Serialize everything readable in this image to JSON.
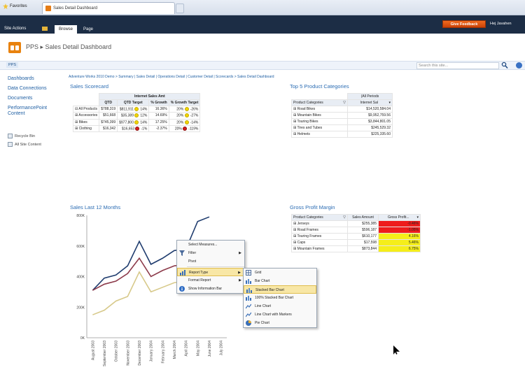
{
  "browser": {
    "favorites_label": "Favorites",
    "tab_title": "Sales Detail Dashboard"
  },
  "ribbon": {
    "site_actions": "Site Actions",
    "tab_browse": "Browse",
    "tab_page": "Page",
    "give_feedback": "Give Feedback",
    "user": "Hej Javahen"
  },
  "header": {
    "title": "PPS ▸ Sales Detail Dashboard",
    "topnav_item": "PPS",
    "search_placeholder": "Search this site..."
  },
  "sidebar": {
    "items": [
      {
        "label": "Dashboards"
      },
      {
        "label": "Data Connections"
      },
      {
        "label": "Documents"
      },
      {
        "label": "PerformancePoint Content"
      }
    ],
    "recycle_bin": "Recycle Bin",
    "all_site_content": "All Site Content"
  },
  "breadcrumb": "Adventure Works 2010 Demo > Summary | Sales Detail | Operations Detail | Customer Detail | Scorecards > Sales Detail Dashboard",
  "scorecard": {
    "title": "Sales Scorecard",
    "group_header": "Internet Sales Amt",
    "columns": [
      "QTD",
      "QTD Target",
      "% Growth",
      "% Growth Target"
    ],
    "rows": [
      {
        "name": "⊟ All Products",
        "qtd": "$788,319",
        "target": "$811,911",
        "target_pct": "14%",
        "growth": "16.36%",
        "growth_target": "20%",
        "growth_pct": "-26%",
        "ind1": "yellow",
        "ind2": "yellow"
      },
      {
        "name": "⊞ Accessories",
        "qtd": "$51,668",
        "target": "$35,389",
        "target_pct": "12%",
        "growth": "14.69%",
        "growth_target": "20%",
        "growth_pct": "-27%",
        "ind1": "yellow",
        "ind2": "yellow"
      },
      {
        "name": "⊞ Bikes",
        "qtd": "$745,399",
        "target": "$977,800",
        "target_pct": "14%",
        "growth": "17.25%",
        "growth_target": "20%",
        "growth_pct": "-14%",
        "ind1": "yellow",
        "ind2": "yellow"
      },
      {
        "name": "⊞ Clothing",
        "qtd": "$16,342",
        "target": "$16,653",
        "target_pct": "-1%",
        "growth": "-2.37%",
        "growth_target": "20%",
        "growth_pct": "-119%",
        "ind1": "red",
        "ind2": "red"
      }
    ]
  },
  "top5": {
    "title": "Top 5 Product Categories",
    "period_header": "(All Periods",
    "col_category": "Product Categories",
    "col_value": "Internet Sal",
    "rows": [
      {
        "name": "⊞ Road Bikes",
        "value": "$14,520,584.04"
      },
      {
        "name": "⊞ Mountain Bikes",
        "value": "$9,952,759.56"
      },
      {
        "name": "⊞ Touring Bikes",
        "value": "$3,844,801.05"
      },
      {
        "name": "⊞ Tires and Tubes",
        "value": "$245,529.32"
      },
      {
        "name": "⊞ Helmets",
        "value": "$225,335.60"
      }
    ]
  },
  "gross_profit": {
    "title": "Gross Profit Margin",
    "col_category": "Product Categories",
    "col_sales": "Sales Amount",
    "col_gp": "Gross Profit...",
    "rows": [
      {
        "name": "⊞ Jerseys",
        "sales": "$255,385",
        "gp": "-0.46%",
        "color": "#ee1c1c"
      },
      {
        "name": "⊞ Road Frames",
        "sales": "$596,187",
        "gp": "-1.05%",
        "color": "#ee1c1c"
      },
      {
        "name": "⊞ Touring Frames",
        "sales": "$610,177",
        "gp": "4.16%",
        "color": "#f5ee1a"
      },
      {
        "name": "⊞ Caps",
        "sales": "$17,598",
        "gp": "5.46%",
        "color": "#f5ee1a"
      },
      {
        "name": "⊞ Mountain Frames",
        "sales": "$873,844",
        "gp": "6.75%",
        "color": "#f5ee1a"
      }
    ]
  },
  "chart_title": "Sales Last 12 Months",
  "context_menu": {
    "items": [
      {
        "label": "Select Measures...",
        "icon": "blank",
        "arrow": false
      },
      {
        "label": "Filter",
        "icon": "filter-icon",
        "arrow": true
      },
      {
        "label": "Pivot",
        "icon": "blank",
        "arrow": false
      },
      {
        "label": "Report Type",
        "icon": "chart-icon",
        "arrow": true,
        "highlight": true
      },
      {
        "label": "Format Report",
        "icon": "blank",
        "arrow": true
      },
      {
        "label": "Show Information Bar",
        "icon": "info-icon",
        "arrow": false
      }
    ]
  },
  "report_type_menu": {
    "items": [
      {
        "label": "Grid",
        "highlight": false
      },
      {
        "label": "Bar Chart",
        "highlight": false
      },
      {
        "label": "Stacked Bar Chart",
        "highlight": true
      },
      {
        "label": "100% Stacked Bar Chart",
        "highlight": false
      },
      {
        "label": "Line Chart",
        "highlight": false
      },
      {
        "label": "Line Chart with Markers",
        "highlight": false
      },
      {
        "label": "Pie Chart",
        "highlight": false
      }
    ]
  },
  "chart_data": {
    "type": "line",
    "title": "Sales Last 12 Months",
    "ylim": [
      0,
      800
    ],
    "y_ticks": [
      "800K",
      "600K",
      "400K",
      "200K",
      "0K"
    ],
    "categories": [
      "August 2003",
      "September 2003",
      "October 2003",
      "November 2003",
      "December 2003",
      "January 2004",
      "February 2004",
      "March 2004",
      "April 2004",
      "May 2004",
      "June 2004",
      "July 2004"
    ],
    "series": [
      {
        "color": "#1f3c6e",
        "values": [
          310,
          390,
          410,
          470,
          630,
          480,
          520,
          570,
          580,
          760,
          790,
          null
        ]
      },
      {
        "color": "#8c3a4a",
        "values": [
          310,
          350,
          370,
          420,
          520,
          400,
          440,
          470,
          480,
          null,
          null,
          null
        ]
      },
      {
        "color": "#d7c98a",
        "values": [
          150,
          180,
          240,
          270,
          430,
          300,
          330,
          360,
          370,
          null,
          null,
          null
        ]
      }
    ]
  }
}
